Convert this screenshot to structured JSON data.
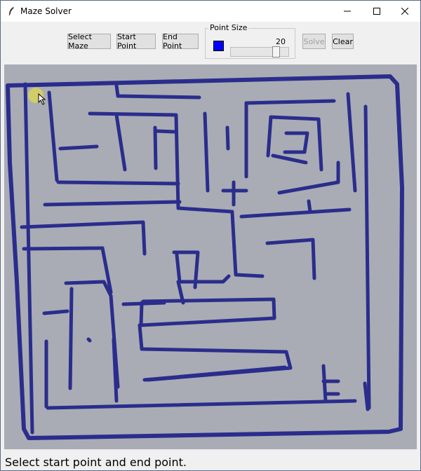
{
  "window": {
    "title": "Maze Solver"
  },
  "toolbar": {
    "select_maze": "Select Maze",
    "start_point": "Start Point",
    "end_point": "End Point",
    "point_size_label": "Point Size",
    "point_size_value": "20",
    "point_size_color": "#0000ff",
    "solve": "Solve",
    "clear": "Clear"
  },
  "status": {
    "message": "Select start point and end point."
  },
  "colors": {
    "maze_ink": "#2a2d8c",
    "canvas_bg": "#a9acb4",
    "cursor_highlight": "#d8d25a"
  },
  "icons": {
    "app": "feather-icon",
    "minimize": "minimize-icon",
    "maximize": "maximize-icon",
    "close": "close-icon"
  }
}
